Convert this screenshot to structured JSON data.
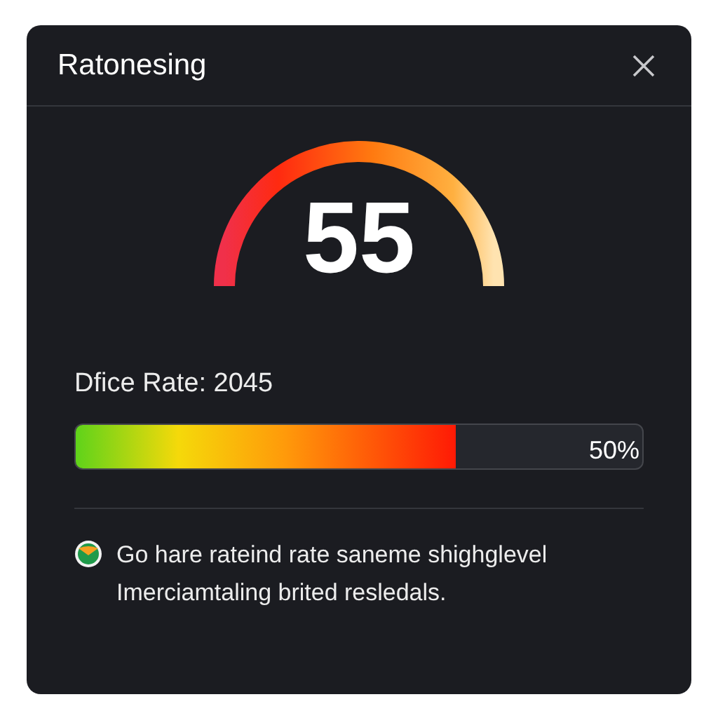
{
  "window": {
    "title": "Ratonesing"
  },
  "gauge": {
    "value": "55"
  },
  "rate": {
    "label": "Dfice Rate: 2045",
    "level": 0.67,
    "reading": "50%"
  },
  "note": {
    "lines": [
      "Go hare rateind rate saneme shighglevel",
      "Imerciamtaling brited resledals."
    ]
  }
}
